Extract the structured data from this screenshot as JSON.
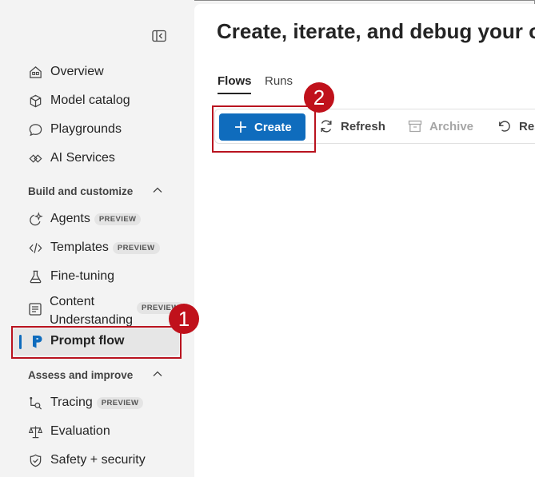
{
  "sidebar": {
    "items": [
      {
        "label": "Overview",
        "icon": "home-icon"
      },
      {
        "label": "Model catalog",
        "icon": "cube-icon"
      },
      {
        "label": "Playgrounds",
        "icon": "chat-icon"
      },
      {
        "label": "AI Services",
        "icon": "ai-services-icon"
      }
    ],
    "sections": [
      {
        "heading": "Build and customize",
        "items": [
          {
            "label": "Agents",
            "badge": "PREVIEW"
          },
          {
            "label": "Templates",
            "badge": "PREVIEW"
          },
          {
            "label": "Fine-tuning"
          },
          {
            "label_line1": "Content",
            "label_line2": "Understanding",
            "badge": "PREVIEW"
          },
          {
            "label": "Prompt flow",
            "selected": true
          }
        ]
      },
      {
        "heading": "Assess and improve",
        "items": [
          {
            "label": "Tracing",
            "badge": "PREVIEW"
          },
          {
            "label": "Evaluation"
          },
          {
            "label": "Safety + security"
          }
        ]
      }
    ]
  },
  "main": {
    "title": "Create, iterate, and debug your o",
    "tabs": [
      {
        "label": "Flows",
        "active": true
      },
      {
        "label": "Runs"
      }
    ],
    "toolbar": {
      "create_label": "Create",
      "refresh_label": "Refresh",
      "archive_label": "Archive",
      "restore_label": "Res"
    }
  },
  "annotations": {
    "step1": "1",
    "step2": "2"
  },
  "colors": {
    "accent": "#0f6cbd",
    "highlight": "#c0111b",
    "sidebar_bg": "#f3f3f3"
  }
}
